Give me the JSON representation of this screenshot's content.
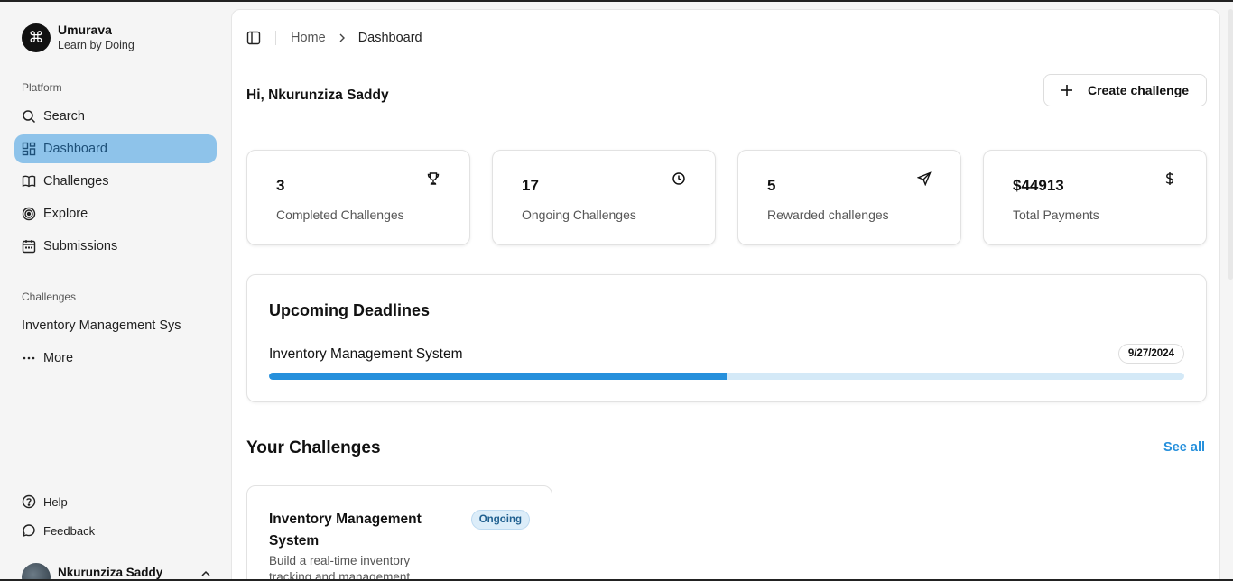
{
  "brand": {
    "name": "Umurava",
    "tagline": "Learn by Doing",
    "logo_icon": "command-icon"
  },
  "sidebar": {
    "platform_label": "Platform",
    "items": [
      {
        "label": "Search",
        "icon": "search-icon"
      },
      {
        "label": "Dashboard",
        "icon": "dashboard-icon",
        "active": true
      },
      {
        "label": "Challenges",
        "icon": "book-icon"
      },
      {
        "label": "Explore",
        "icon": "target-icon"
      },
      {
        "label": "Submissions",
        "icon": "calendar-icon"
      }
    ],
    "challenges_label": "Challenges",
    "challenge_link": "Inventory Management Sys",
    "more_label": "More",
    "help_label": "Help",
    "feedback_label": "Feedback",
    "user_name": "Nkurunziza Saddy"
  },
  "breadcrumb": {
    "home": "Home",
    "current": "Dashboard"
  },
  "greeting": "Hi, Nkurunziza Saddy",
  "create_button": "Create challenge",
  "stats": [
    {
      "value": "3",
      "label": "Completed Challenges",
      "icon": "trophy-icon"
    },
    {
      "value": "17",
      "label": "Ongoing Challenges",
      "icon": "clock-icon"
    },
    {
      "value": "5",
      "label": "Rewarded challenges",
      "icon": "send-icon"
    },
    {
      "value": "$44913",
      "label": "Total Payments",
      "icon": "dollar-icon"
    }
  ],
  "deadlines": {
    "title": "Upcoming Deadlines",
    "item_name": "Inventory Management System",
    "item_date": "9/27/2024",
    "progress": 0.5
  },
  "your_challenges": {
    "title": "Your Challenges",
    "see_all": "See all",
    "card": {
      "title": "Inventory Management System",
      "status": "Ongoing",
      "description": "Build a real-time inventory tracking and management"
    }
  },
  "colors": {
    "accent": "#2690dc",
    "active_nav": "#8ec3ea",
    "progress_track": "#d4e9f7"
  }
}
